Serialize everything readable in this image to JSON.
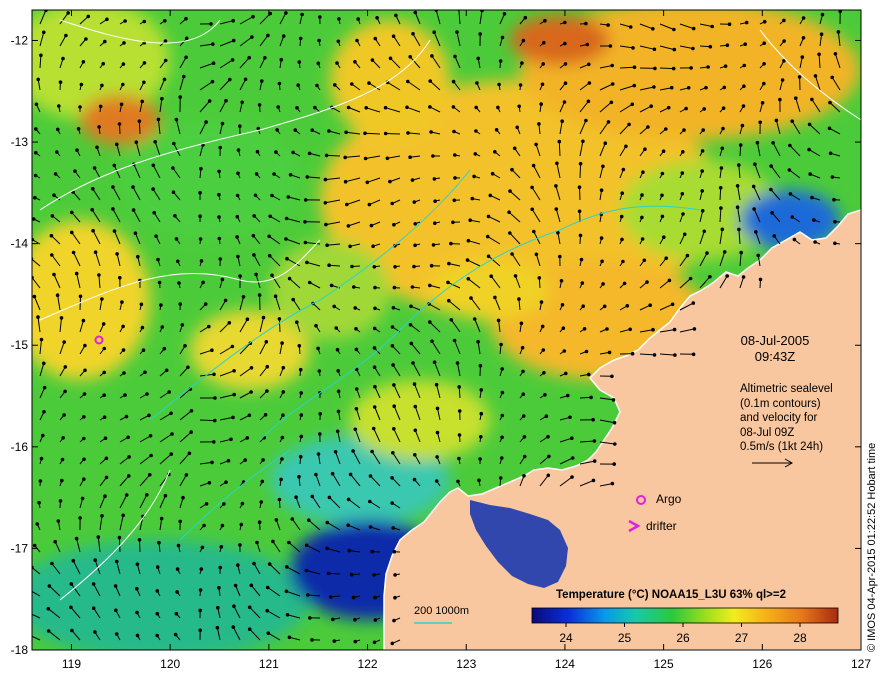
{
  "map": {
    "x_axis_ticks": [
      "119",
      "120",
      "121",
      "122",
      "123",
      "124",
      "125",
      "126",
      "127"
    ],
    "y_axis_ticks": [
      "-12",
      "-13",
      "-14",
      "-15",
      "-16",
      "-17",
      "-18"
    ],
    "lon_range": [
      118.6,
      127.0
    ],
    "lat_range": [
      -18.0,
      -11.7
    ],
    "land_color": "#f9c79f",
    "contour_color": "#2ad4c8"
  },
  "date": {
    "day": "08-Jul-2005",
    "time": "09:43Z"
  },
  "altimetry": {
    "line1": "Altimetric sealevel",
    "line2": "(0.1m contours)",
    "line3": "and velocity for",
    "line4": "08-Jul 09Z",
    "line5": "0.5m/s (1kt 24h)"
  },
  "credit": "© IMOS 04-Apr-2015 01:22:52 Hobart time",
  "colorbar": {
    "title": "Temperature (°C) NOAA15_L3U 63% ql>=2",
    "ticks": [
      "24",
      "25",
      "26",
      "27",
      "28"
    ]
  },
  "legend": {
    "argo": "Argo",
    "drifter": "drifter",
    "contour": "200  1000m",
    "argo_color": "#e020e0"
  }
}
